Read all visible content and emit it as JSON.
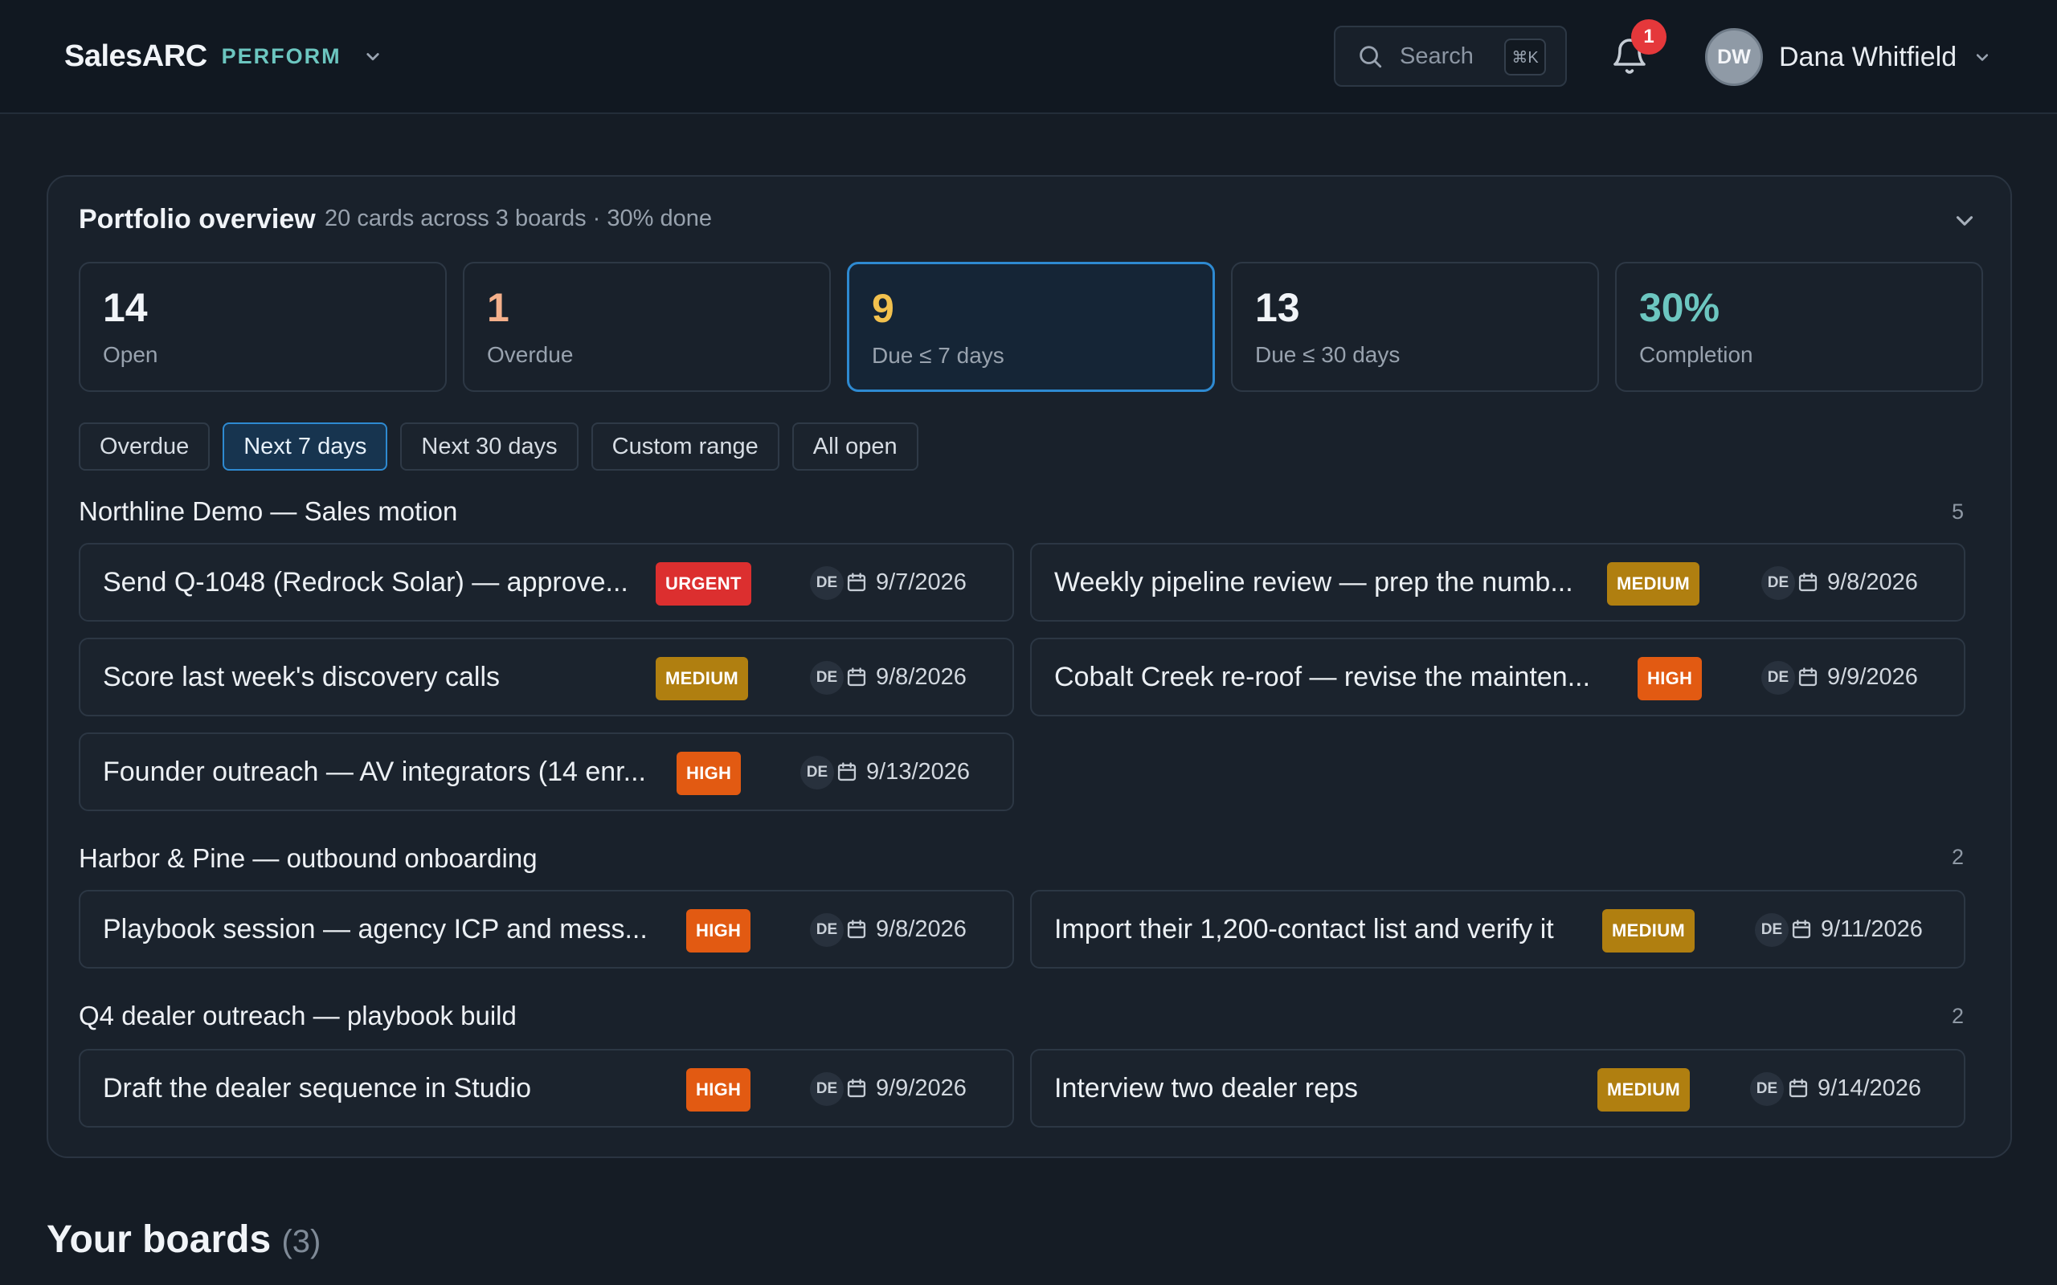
{
  "header": {
    "brand": "SalesARC",
    "mode": "PERFORM",
    "search_placeholder": "Search",
    "search_shortcut": "⌘K",
    "notification_count": "1",
    "user": {
      "initials": "DW",
      "name": "Dana Whitfield"
    }
  },
  "portfolio": {
    "title": "Portfolio overview",
    "subtitle": "20 cards across 3 boards · 30% done",
    "stats": [
      {
        "value": "14",
        "label": "Open",
        "color": "#f1f4f8"
      },
      {
        "value": "1",
        "label": "Overdue",
        "color": "#f4b08b"
      },
      {
        "value": "9",
        "label": "Due ≤ 7 days",
        "color": "#f2c14e"
      },
      {
        "value": "13",
        "label": "Due ≤ 30 days",
        "color": "#f1f4f8"
      },
      {
        "value": "30%",
        "label": "Completion",
        "color": "#6cc6c0"
      }
    ],
    "filters": [
      "Overdue",
      "Next 7 days",
      "Next 30 days",
      "Custom range",
      "All open"
    ],
    "active_filter": "Next 7 days",
    "groups": [
      {
        "title": "Northline Demo — Sales motion",
        "count": "5",
        "tasks": [
          {
            "title": "Send Q-1048 (Redrock Solar) — approve...",
            "priority": "URGENT",
            "assignee": "DE",
            "due": "9/7/2026"
          },
          {
            "title": "Weekly pipeline review — prep the numb...",
            "priority": "MEDIUM",
            "assignee": "DE",
            "due": "9/8/2026"
          },
          {
            "title": "Score last week's discovery calls",
            "priority": "MEDIUM",
            "assignee": "DE",
            "due": "9/8/2026"
          },
          {
            "title": "Cobalt Creek re-roof — revise the mainten...",
            "priority": "HIGH",
            "assignee": "DE",
            "due": "9/9/2026"
          },
          {
            "title": "Founder outreach — AV integrators (14 enr...",
            "priority": "HIGH",
            "assignee": "DE",
            "due": "9/13/2026"
          }
        ]
      },
      {
        "title": "Harbor & Pine — outbound onboarding",
        "count": "2",
        "tasks": [
          {
            "title": "Playbook session — agency ICP and mess...",
            "priority": "HIGH",
            "assignee": "DE",
            "due": "9/8/2026"
          },
          {
            "title": "Import their 1,200-contact list and verify it",
            "priority": "MEDIUM",
            "assignee": "DE",
            "due": "9/11/2026"
          }
        ]
      },
      {
        "title": "Q4 dealer outreach — playbook build",
        "count": "2",
        "tasks": [
          {
            "title": "Draft the dealer sequence in Studio",
            "priority": "HIGH",
            "assignee": "DE",
            "due": "9/9/2026"
          },
          {
            "title": "Interview two dealer reps",
            "priority": "MEDIUM",
            "assignee": "DE",
            "due": "9/14/2026"
          }
        ]
      }
    ]
  },
  "boards": {
    "heading": "Your boards",
    "count": "(3)"
  }
}
